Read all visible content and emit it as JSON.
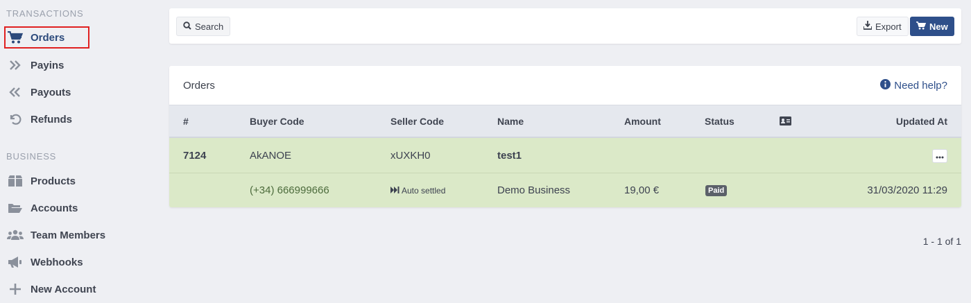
{
  "sidebar": {
    "sections": [
      {
        "title": "TRANSACTIONS",
        "items": [
          {
            "label": "Orders",
            "icon": "cart-icon",
            "active": true
          },
          {
            "label": "Payins",
            "icon": "double-chevron-right-icon"
          },
          {
            "label": "Payouts",
            "icon": "double-chevron-left-icon"
          },
          {
            "label": "Refunds",
            "icon": "undo-icon"
          }
        ]
      },
      {
        "title": "BUSINESS",
        "items": [
          {
            "label": "Products",
            "icon": "box-icon"
          },
          {
            "label": "Accounts",
            "icon": "folder-open-icon"
          },
          {
            "label": "Team Members",
            "icon": "users-icon"
          },
          {
            "label": "Webhooks",
            "icon": "bullhorn-icon"
          },
          {
            "label": "New Account",
            "icon": "plus-icon"
          }
        ]
      }
    ]
  },
  "toolbar": {
    "search_label": "Search",
    "export_label": "Export",
    "new_label": "New"
  },
  "orders": {
    "title": "Orders",
    "help_label": "Need help?",
    "columns": [
      "#",
      "Buyer Code",
      "Seller Code",
      "Name",
      "Amount",
      "Status",
      "",
      "Updated At"
    ],
    "rows": [
      {
        "id": "7124",
        "buyer_code": "AkANOE",
        "seller_code": "xUXKH0",
        "name": "test1",
        "buyer_phone": "(+34) 666999666",
        "seller_status": "Auto settled",
        "business": "Demo Business",
        "amount": "19,00 €",
        "status": "Paid",
        "updated_at": "31/03/2020 11:29"
      }
    ]
  },
  "pagination": {
    "label": "1 - 1 of 1"
  },
  "colors": {
    "primary": "#2e4f8a",
    "row_paid_bg": "#dbe9c8",
    "active_outline": "#e02020"
  }
}
